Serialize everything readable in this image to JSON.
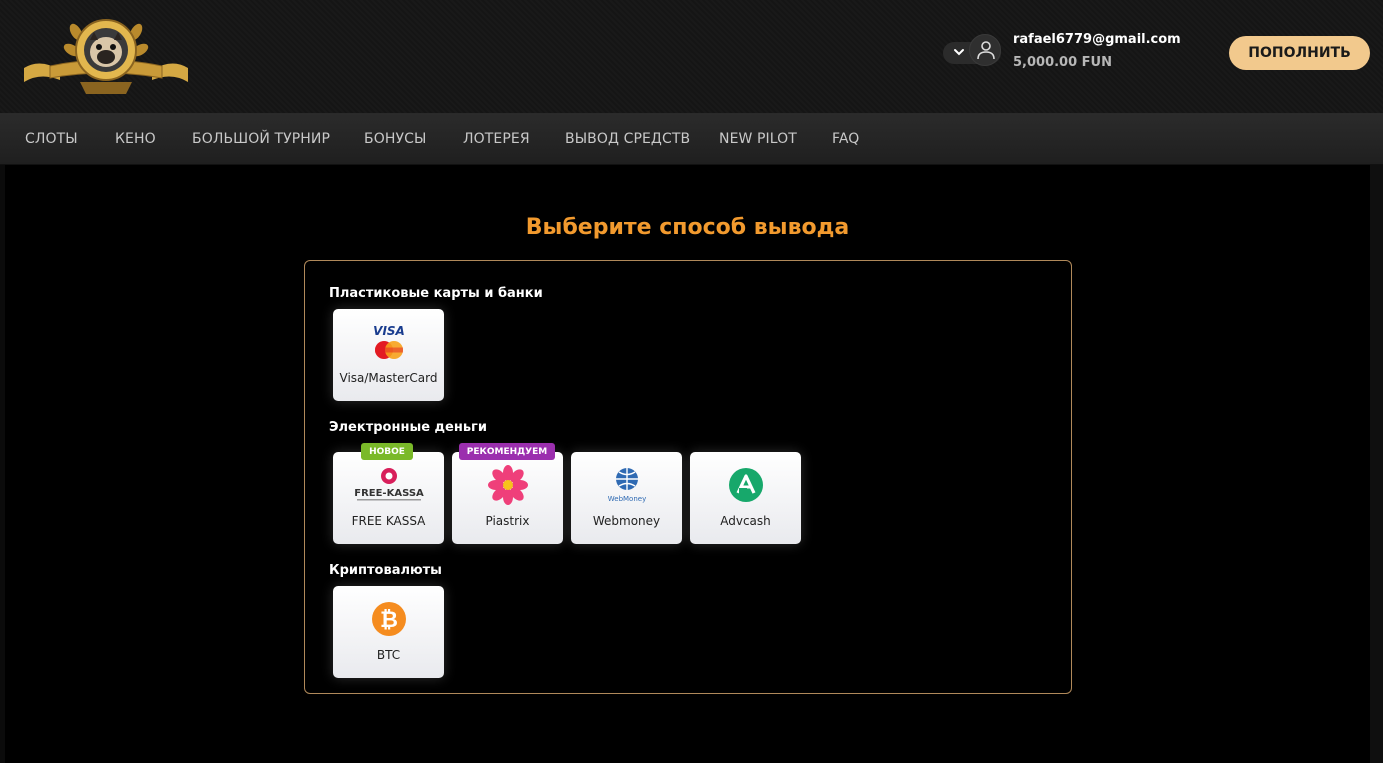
{
  "header": {
    "logo_alt": "pug lion logo",
    "user": {
      "email": "rafael6779@gmail.com",
      "balance": "5,000.00 FUN"
    },
    "deposit_label": "ПОПОЛНИТЬ"
  },
  "nav": {
    "items": [
      {
        "label": "СЛОТЫ"
      },
      {
        "label": "КЕНО"
      },
      {
        "label": "БОЛЬШОЙ ТУРНИР"
      },
      {
        "label": "БОНУСЫ"
      },
      {
        "label": "ЛОТЕРЕЯ"
      },
      {
        "label": "ВЫВОД СРЕДСТВ"
      },
      {
        "label": "NEW PILOT"
      },
      {
        "label": "FAQ"
      }
    ]
  },
  "main": {
    "title": "Выберите способ вывода",
    "sections": [
      {
        "title": "Пластиковые карты и банки",
        "methods": [
          {
            "label": "Visa/MasterCard",
            "icon": "visa-mastercard-icon"
          }
        ]
      },
      {
        "title": "Электронные деньги",
        "methods": [
          {
            "label": "FREE KASSA",
            "icon": "free-kassa-icon",
            "badge": "НОВОЕ",
            "badge_color": "#7ab929"
          },
          {
            "label": "Piastrix",
            "icon": "piastrix-icon",
            "badge": "РЕКОМЕНДУЕМ",
            "badge_color": "#9b2fae"
          },
          {
            "label": "Webmoney",
            "icon": "webmoney-icon"
          },
          {
            "label": "Advcash",
            "icon": "advcash-icon"
          }
        ]
      },
      {
        "title": "Криптовалюты",
        "methods": [
          {
            "label": "BTC",
            "icon": "bitcoin-icon"
          }
        ]
      }
    ]
  },
  "colors": {
    "accent": "#f29a2e",
    "deposit_button": "#f2c98d",
    "panel_border": "#b0895a"
  }
}
